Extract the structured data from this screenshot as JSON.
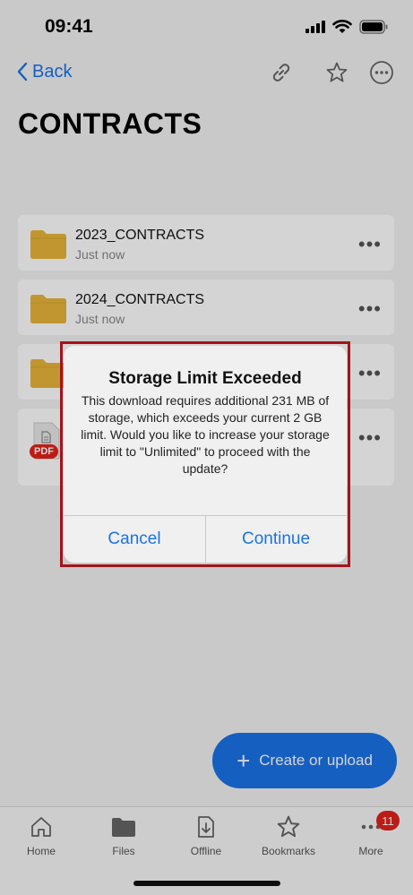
{
  "status": {
    "time": "09:41"
  },
  "nav": {
    "back_label": "Back"
  },
  "page": {
    "title": "CONTRACTS"
  },
  "items": [
    {
      "name": "2023_CONTRACTS",
      "sub": "Just now",
      "type": "folder"
    },
    {
      "name": "2024_CONTRACTS",
      "sub": "Just now",
      "type": "folder"
    },
    {
      "name": "",
      "sub": "",
      "type": "folder"
    },
    {
      "name": "",
      "sub": "",
      "type": "pdf",
      "badge": "PDF"
    }
  ],
  "fab": {
    "label": "Create or upload"
  },
  "tabs": [
    {
      "label": "Home",
      "icon": "home-icon"
    },
    {
      "label": "Files",
      "icon": "folder-icon"
    },
    {
      "label": "Offline",
      "icon": "offline-download-icon"
    },
    {
      "label": "Bookmarks",
      "icon": "star-icon"
    },
    {
      "label": "More",
      "icon": "more-icon",
      "badge": "11"
    }
  ],
  "dialog": {
    "title": "Storage Limit Exceeded",
    "message": "This download requires additional 231 MB of storage, which exceeds your current 2 GB limit. Would you like to increase your storage limit to \"Unlimited\" to proceed with the update?",
    "cancel_label": "Cancel",
    "continue_label": "Continue"
  },
  "colors": {
    "accent": "#1a73e8",
    "folder": "#e8b53a",
    "pdf_badge": "#e0241b",
    "dialog_border": "#a3141a"
  }
}
